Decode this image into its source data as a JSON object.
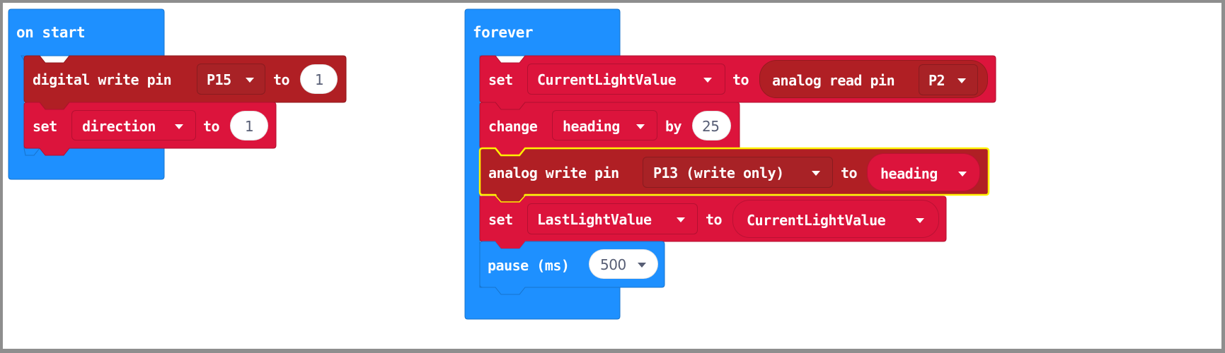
{
  "colors": {
    "event_blue": "#1e90ff",
    "pins_darkred": "#b01f24",
    "variables_crimson": "#dc143c",
    "selection_yellow": "#fff200",
    "value_text": "#575e75"
  },
  "on_start": {
    "label": "on start",
    "blocks": {
      "digital_write": {
        "label": "digital write pin",
        "pin": "P15",
        "to_label": "to",
        "value": "1"
      },
      "set_direction": {
        "set_label": "set",
        "variable": "direction",
        "to_label": "to",
        "value": "1"
      }
    }
  },
  "forever": {
    "label": "forever",
    "blocks": {
      "set_current": {
        "set_label": "set",
        "variable": "CurrentLightValue",
        "to_label": "to",
        "reporter": {
          "label": "analog read pin",
          "pin": "P2"
        }
      },
      "change_heading": {
        "change_label": "change",
        "variable": "heading",
        "by_label": "by",
        "value": "25"
      },
      "analog_write": {
        "label": "analog write pin",
        "pin": "P13 (write only)",
        "to_label": "to",
        "variable": "heading",
        "selected": true
      },
      "set_last": {
        "set_label": "set",
        "variable": "LastLightValue",
        "to_label": "to",
        "value_variable": "CurrentLightValue"
      },
      "pause": {
        "label": "pause (ms)",
        "value": "500"
      }
    }
  }
}
